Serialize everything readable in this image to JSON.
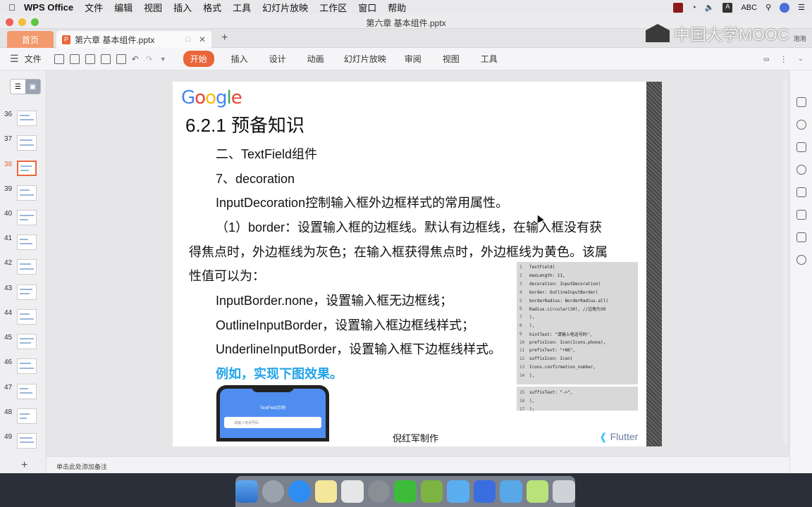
{
  "menubar": {
    "app_name": "WPS Office",
    "items": [
      "文件",
      "编辑",
      "视图",
      "插入",
      "格式",
      "工具",
      "幻灯片放映",
      "工作区",
      "窗口",
      "帮助"
    ],
    "input_method": "ABC"
  },
  "window": {
    "title": "第六章 基本组件.pptx"
  },
  "tabs": {
    "home": "首页",
    "doc": "第六章 基本组件.pptx",
    "new_tab": "+"
  },
  "watermark": {
    "brand": "中国大学MOOC",
    "user": "泡泡"
  },
  "toolbar": {
    "file_label": "文件",
    "ribbon_tabs": [
      "开始",
      "插入",
      "设计",
      "动画",
      "幻灯片放映",
      "审阅",
      "视图",
      "工具"
    ]
  },
  "thumbnails": [
    "36",
    "37",
    "38",
    "39",
    "40",
    "41",
    "42",
    "43",
    "44",
    "45",
    "46",
    "47",
    "48",
    "49"
  ],
  "selected_slide": "38",
  "slide": {
    "logo": "Google",
    "title": "6.2.1 预备知识",
    "line1": "二、TextField组件",
    "line2": "7、decoration",
    "line3": "InputDecoration控制输入框外边框样式的常用属性。",
    "line4": "（1）border：设置输入框的边框线。默认有边框线，在输入框没有获",
    "line5": "得焦点时，外边框线为灰色；在输入框获得焦点时，外边框线为黄色。该属",
    "line6": "性值可以为：",
    "line7": "InputBorder.none，设置输入框无边框线；",
    "line8": "OutlineInputBorder，设置输入框边框线样式；",
    "line9": "UnderlineInputBorder，设置输入框下边框线样式。",
    "example": "例如，实现下图效果。",
    "phone_title": "TextField示例",
    "phone_hint": "请输入电话号码",
    "author": "倪红军制作",
    "flutter": "Flutter"
  },
  "code": {
    "lines": [
      {
        "n": "1",
        "t": "TextField("
      },
      {
        "n": "2",
        "t": "    maxLength: 11,"
      },
      {
        "n": "3",
        "t": "    decoration: InputDecoration("
      },
      {
        "n": "4",
        "t": "      border: OutlineInputBorder("
      },
      {
        "n": "5",
        "t": "          borderRadius: BorderRadius.all("
      },
      {
        "n": "6",
        "t": "            Radius.circular(30), //边角为30"
      },
      {
        "n": "7",
        "t": "          ),"
      },
      {
        "n": "8",
        "t": "      ),"
      },
      {
        "n": "9",
        "t": "      hintText: \"请输入电话号码\","
      },
      {
        "n": "10",
        "t": "      prefixIcon: Icon(Icons.phone),"
      },
      {
        "n": "11",
        "t": "      prefixText: \"+86\","
      },
      {
        "n": "12",
        "t": "      suffixIcon: Icon("
      },
      {
        "n": "13",
        "t": "        Icons.confirmation_number,"
      },
      {
        "n": "14",
        "t": "      ),"
      }
    ],
    "lines2": [
      {
        "n": "15",
        "t": "      suffixText: \"->\","
      },
      {
        "n": "16",
        "t": "    ),"
      },
      {
        "n": "17",
        "t": "  );"
      }
    ]
  },
  "notes": {
    "placeholder": "单击此处添加备注"
  },
  "colors": {
    "accent": "#e9663a",
    "example_blue": "#23a4e8"
  }
}
